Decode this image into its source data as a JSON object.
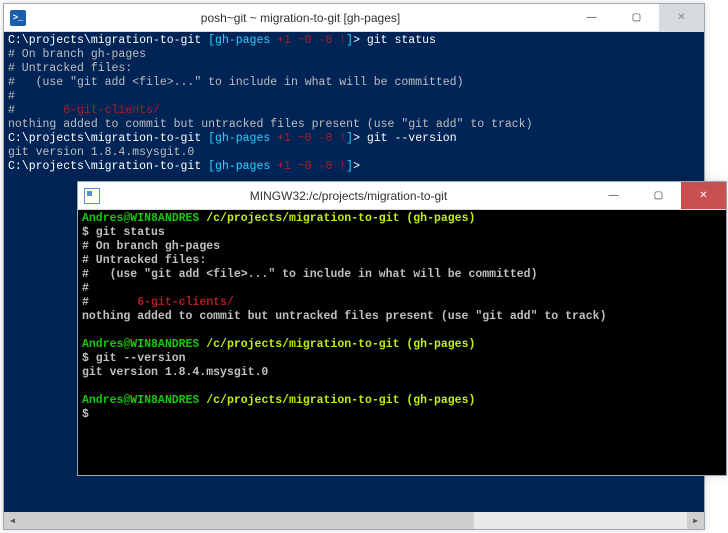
{
  "posh": {
    "title": "posh~git ~ migration-to-git [gh-pages]",
    "lines": [
      [
        {
          "cls": "white",
          "t": "C:\\projects\\migration-to-git "
        },
        {
          "cls": "cyan",
          "t": "[gh-pages "
        },
        {
          "cls": "dred",
          "t": "+1 ~0 -0 !"
        },
        {
          "cls": "cyan",
          "t": "]"
        },
        {
          "cls": "white",
          "t": "> git status"
        }
      ],
      [
        {
          "cls": "gray",
          "t": "# On branch gh-pages"
        }
      ],
      [
        {
          "cls": "gray",
          "t": "# Untracked files:"
        }
      ],
      [
        {
          "cls": "gray",
          "t": "#   (use \"git add <file>...\" to include in what will be committed)"
        }
      ],
      [
        {
          "cls": "gray",
          "t": "#"
        }
      ],
      [
        {
          "cls": "gray",
          "t": "#       "
        },
        {
          "cls": "dred",
          "t": "6-git-clients/"
        }
      ],
      [
        {
          "cls": "gray",
          "t": "nothing added to commit but untracked files present (use \"git add\" to track)"
        }
      ],
      [
        {
          "cls": "white",
          "t": "C:\\projects\\migration-to-git "
        },
        {
          "cls": "cyan",
          "t": "[gh-pages "
        },
        {
          "cls": "dred",
          "t": "+1 ~0 -0 !"
        },
        {
          "cls": "cyan",
          "t": "]"
        },
        {
          "cls": "white",
          "t": "> git --version"
        }
      ],
      [
        {
          "cls": "gray",
          "t": "git version 1.8.4.msysgit.0"
        }
      ],
      [
        {
          "cls": "white",
          "t": "C:\\projects\\migration-to-git "
        },
        {
          "cls": "cyan",
          "t": "[gh-pages "
        },
        {
          "cls": "dred",
          "t": "+1 ~0 -0 !"
        },
        {
          "cls": "cyan",
          "t": "]"
        },
        {
          "cls": "white",
          "t": ">"
        }
      ]
    ]
  },
  "mingw": {
    "title": "MINGW32:/c/projects/migration-to-git",
    "lines": [
      [
        {
          "cls": "green",
          "t": "Andres@WIN8ANDRES "
        },
        {
          "cls": "lime",
          "t": "/c/projects/migration-to-git (gh-pages)"
        }
      ],
      [
        {
          "cls": "",
          "t": "$ git status"
        }
      ],
      [
        {
          "cls": "",
          "t": "# On branch gh-pages"
        }
      ],
      [
        {
          "cls": "",
          "t": "# Untracked files:"
        }
      ],
      [
        {
          "cls": "",
          "t": "#   (use \"git add <file>...\" to include in what will be committed)"
        }
      ],
      [
        {
          "cls": "",
          "t": "#"
        }
      ],
      [
        {
          "cls": "",
          "t": "#       "
        },
        {
          "cls": "dred",
          "t": "6-git-clients/"
        }
      ],
      [
        {
          "cls": "",
          "t": "nothing added to commit but untracked files present (use \"git add\" to track)"
        }
      ],
      [
        {
          "cls": "",
          "t": ""
        }
      ],
      [
        {
          "cls": "green",
          "t": "Andres@WIN8ANDRES "
        },
        {
          "cls": "lime",
          "t": "/c/projects/migration-to-git (gh-pages)"
        }
      ],
      [
        {
          "cls": "",
          "t": "$ git --version"
        }
      ],
      [
        {
          "cls": "",
          "t": "git version 1.8.4.msysgit.0"
        }
      ],
      [
        {
          "cls": "",
          "t": ""
        }
      ],
      [
        {
          "cls": "green",
          "t": "Andres@WIN8ANDRES "
        },
        {
          "cls": "lime",
          "t": "/c/projects/migration-to-git (gh-pages)"
        }
      ],
      [
        {
          "cls": "",
          "t": "$"
        }
      ]
    ]
  },
  "glyph": {
    "min": "—",
    "max": "▢",
    "close": "✕",
    "left": "◀",
    "right": "▶"
  }
}
